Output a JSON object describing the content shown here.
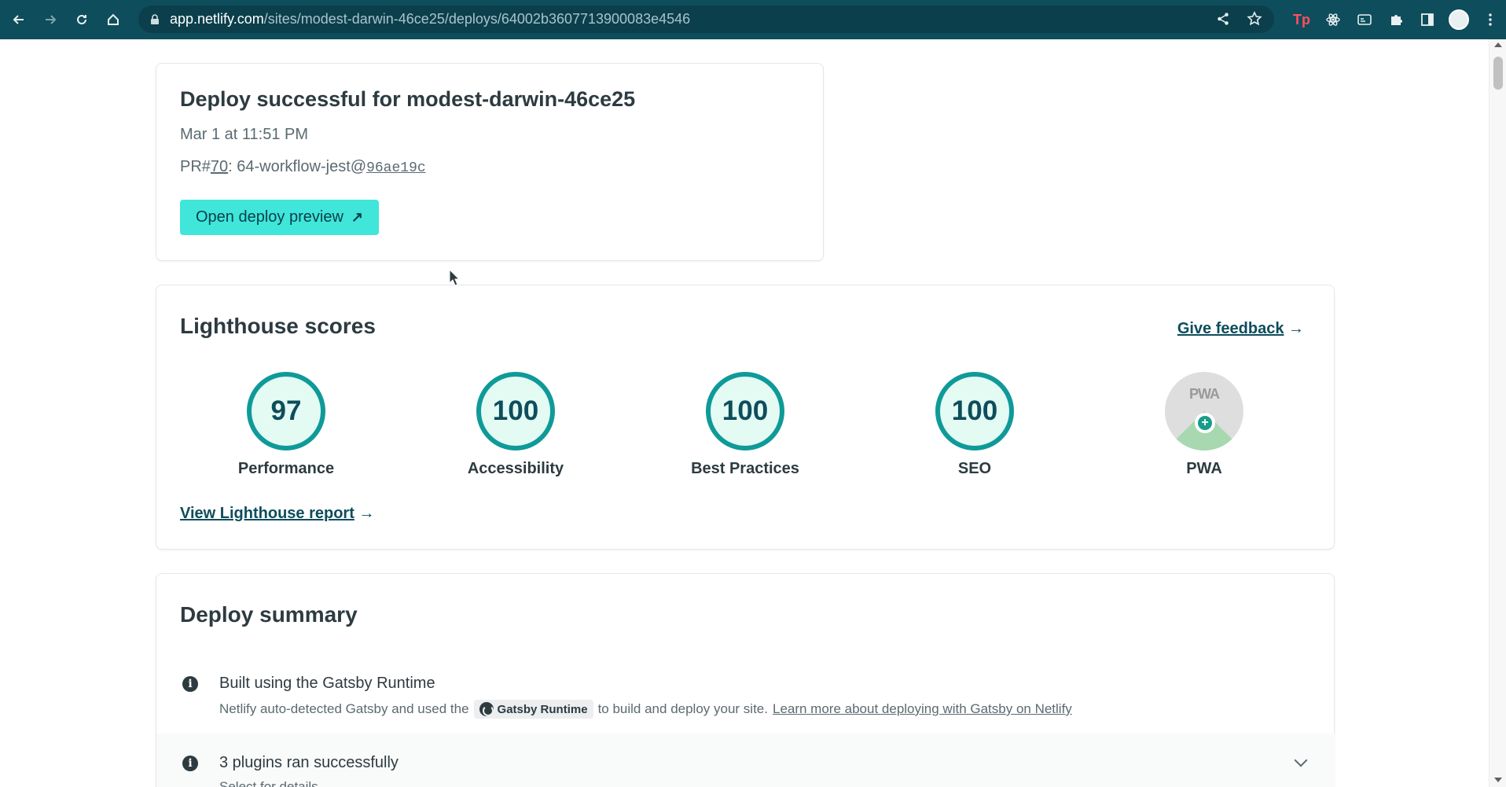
{
  "browser": {
    "url_host": "app.netlify.com",
    "url_path": "/sites/modest-darwin-46ce25/deploys/64002b3607713900083e4546",
    "extensions": [
      "share-icon",
      "star-icon",
      "tp-extension-icon",
      "react-devtools-icon",
      "media-icon",
      "puzzle-icon",
      "sidebar-icon",
      "profile-avatar",
      "kebab-menu-icon"
    ],
    "tp_label": "Tp"
  },
  "deploy": {
    "title": "Deploy successful for modest-darwin-46ce25",
    "date": "Mar 1 at 11:51 PM",
    "pr_prefix": "PR#",
    "pr_number": "70",
    "pr_branch": ": 64-workflow-jest@",
    "commit": "96ae19c",
    "preview_label": "Open deploy preview",
    "preview_arrow": "↗"
  },
  "lighthouse": {
    "title": "Lighthouse scores",
    "feedback_label": "Give feedback",
    "feedback_arrow": "→",
    "scores": [
      {
        "label": "Performance",
        "value": "97"
      },
      {
        "label": "Accessibility",
        "value": "100"
      },
      {
        "label": "Best Practices",
        "value": "100"
      },
      {
        "label": "SEO",
        "value": "100"
      }
    ],
    "pwa": {
      "label": "PWA",
      "badge_text": "PWA",
      "plus": "+"
    },
    "report_label": "View Lighthouse report",
    "report_arrow": "→"
  },
  "summary": {
    "title": "Deploy summary",
    "rows": [
      {
        "title": "Built using the Gatsby Runtime",
        "desc_before": "Netlify auto-detected Gatsby and used the",
        "chip": "Gatsby Runtime",
        "desc_after": "to build and deploy your site.",
        "link": "Learn more about deploying with Gatsby on Netlify"
      },
      {
        "title": "3 plugins ran successfully",
        "desc": "Select for details."
      }
    ],
    "info_glyph": "i"
  },
  "colors": {
    "chrome": "#0e4d5c",
    "accent_button": "#3fe6d9",
    "ring": "#0f9a99",
    "ring_fill": "#e3fbf3"
  }
}
